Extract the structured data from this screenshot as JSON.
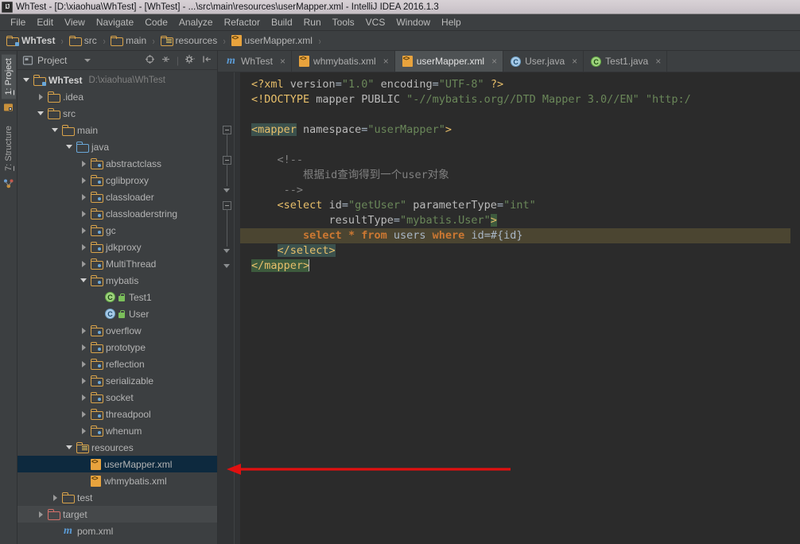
{
  "window": {
    "title": "WhTest - [D:\\xiaohua\\WhTest] - [WhTest] - ...\\src\\main\\resources\\userMapper.xml - IntelliJ IDEA 2016.1.3",
    "app_icon": "IJ"
  },
  "menubar": {
    "items": [
      {
        "label": "File",
        "mnemonic": "F"
      },
      {
        "label": "Edit",
        "mnemonic": "E"
      },
      {
        "label": "View",
        "mnemonic": "V"
      },
      {
        "label": "Navigate",
        "mnemonic": "N"
      },
      {
        "label": "Code",
        "mnemonic": "C"
      },
      {
        "label": "Analyze",
        "mnemonic": "A"
      },
      {
        "label": "Refactor",
        "mnemonic": "R"
      },
      {
        "label": "Build",
        "mnemonic": "B"
      },
      {
        "label": "Run",
        "mnemonic": "R"
      },
      {
        "label": "Tools",
        "mnemonic": "T"
      },
      {
        "label": "VCS",
        "mnemonic": "V"
      },
      {
        "label": "Window",
        "mnemonic": "W"
      },
      {
        "label": "Help",
        "mnemonic": "H"
      }
    ]
  },
  "breadcrumb": {
    "items": [
      {
        "label": "WhTest",
        "icon": "module-folder-icon"
      },
      {
        "label": "src",
        "icon": "folder-icon"
      },
      {
        "label": "main",
        "icon": "folder-icon"
      },
      {
        "label": "resources",
        "icon": "resources-folder-icon"
      },
      {
        "label": "userMapper.xml",
        "icon": "xml-file-icon"
      }
    ],
    "separator": "›"
  },
  "toolstrip": {
    "buttons": [
      {
        "num": "1",
        "label": ": Project",
        "active": true,
        "icon": "project-icon"
      },
      {
        "num": "7",
        "label": ": Structure",
        "active": false,
        "icon": "structure-icon"
      }
    ]
  },
  "project_panel": {
    "header": {
      "title": "Project",
      "icon": "project-view-icon",
      "dropdown": "chevron-down-icon",
      "tools": [
        "locate-icon",
        "collapse-all-icon",
        "settings-gear-icon",
        "hide-panel-icon"
      ]
    },
    "tree": [
      {
        "label": "WhTest",
        "sub": "D:\\xiaohua\\WhTest",
        "depth": 0,
        "arrow": "open",
        "icon": "module-folder-icon",
        "bold": true,
        "state": "normal"
      },
      {
        "label": ".idea",
        "sub": "",
        "depth": 1,
        "arrow": "closed",
        "icon": "folder-icon",
        "bold": false,
        "state": "normal"
      },
      {
        "label": "src",
        "sub": "",
        "depth": 1,
        "arrow": "open",
        "icon": "folder-icon",
        "bold": false,
        "state": "normal"
      },
      {
        "label": "main",
        "sub": "",
        "depth": 2,
        "arrow": "open",
        "icon": "folder-icon",
        "bold": false,
        "state": "normal"
      },
      {
        "label": "java",
        "sub": "",
        "depth": 3,
        "arrow": "open",
        "icon": "source-folder-icon",
        "bold": false,
        "state": "normal"
      },
      {
        "label": "abstractclass",
        "sub": "",
        "depth": 4,
        "arrow": "closed",
        "icon": "package-icon",
        "bold": false,
        "state": "normal"
      },
      {
        "label": "cglibproxy",
        "sub": "",
        "depth": 4,
        "arrow": "closed",
        "icon": "package-icon",
        "bold": false,
        "state": "normal"
      },
      {
        "label": "classloader",
        "sub": "",
        "depth": 4,
        "arrow": "closed",
        "icon": "package-icon",
        "bold": false,
        "state": "normal"
      },
      {
        "label": "classloaderstring",
        "sub": "",
        "depth": 4,
        "arrow": "closed",
        "icon": "package-icon",
        "bold": false,
        "state": "normal"
      },
      {
        "label": "gc",
        "sub": "",
        "depth": 4,
        "arrow": "closed",
        "icon": "package-icon",
        "bold": false,
        "state": "normal"
      },
      {
        "label": "jdkproxy",
        "sub": "",
        "depth": 4,
        "arrow": "closed",
        "icon": "package-icon",
        "bold": false,
        "state": "normal"
      },
      {
        "label": "MultiThread",
        "sub": "",
        "depth": 4,
        "arrow": "closed",
        "icon": "package-icon",
        "bold": false,
        "state": "normal"
      },
      {
        "label": "mybatis",
        "sub": "",
        "depth": 4,
        "arrow": "open",
        "icon": "package-icon",
        "bold": false,
        "state": "normal"
      },
      {
        "label": "Test1",
        "sub": "",
        "depth": 5,
        "arrow": "none",
        "icon": "runnable-class-icon",
        "bold": false,
        "state": "normal"
      },
      {
        "label": "User",
        "sub": "",
        "depth": 5,
        "arrow": "none",
        "icon": "class-icon",
        "bold": false,
        "state": "normal"
      },
      {
        "label": "overflow",
        "sub": "",
        "depth": 4,
        "arrow": "closed",
        "icon": "package-icon",
        "bold": false,
        "state": "normal"
      },
      {
        "label": "prototype",
        "sub": "",
        "depth": 4,
        "arrow": "closed",
        "icon": "package-icon",
        "bold": false,
        "state": "normal"
      },
      {
        "label": "reflection",
        "sub": "",
        "depth": 4,
        "arrow": "closed",
        "icon": "package-icon",
        "bold": false,
        "state": "normal"
      },
      {
        "label": "serializable",
        "sub": "",
        "depth": 4,
        "arrow": "closed",
        "icon": "package-icon",
        "bold": false,
        "state": "normal"
      },
      {
        "label": "socket",
        "sub": "",
        "depth": 4,
        "arrow": "closed",
        "icon": "package-icon",
        "bold": false,
        "state": "normal"
      },
      {
        "label": "threadpool",
        "sub": "",
        "depth": 4,
        "arrow": "closed",
        "icon": "package-icon",
        "bold": false,
        "state": "normal"
      },
      {
        "label": "whenum",
        "sub": "",
        "depth": 4,
        "arrow": "closed",
        "icon": "package-icon",
        "bold": false,
        "state": "normal"
      },
      {
        "label": "resources",
        "sub": "",
        "depth": 3,
        "arrow": "open",
        "icon": "resources-folder-icon",
        "bold": false,
        "state": "normal"
      },
      {
        "label": "userMapper.xml",
        "sub": "",
        "depth": 4,
        "arrow": "none",
        "icon": "xml-file-icon",
        "bold": false,
        "state": "selected"
      },
      {
        "label": "whmybatis.xml",
        "sub": "",
        "depth": 4,
        "arrow": "none",
        "icon": "xml-file-icon",
        "bold": false,
        "state": "normal"
      },
      {
        "label": "test",
        "sub": "",
        "depth": 2,
        "arrow": "closed",
        "icon": "folder-icon",
        "bold": false,
        "state": "normal"
      },
      {
        "label": "target",
        "sub": "",
        "depth": 1,
        "arrow": "closed",
        "icon": "excluded-folder-icon",
        "bold": false,
        "state": "hovered"
      },
      {
        "label": "pom.xml",
        "sub": "",
        "depth": 2,
        "arrow": "none",
        "icon": "maven-icon",
        "bold": false,
        "state": "normal"
      }
    ]
  },
  "editor_tabs": [
    {
      "label": "WhTest",
      "icon": "maven-icon",
      "active": false,
      "close": "×"
    },
    {
      "label": "whmybatis.xml",
      "icon": "xml-file-icon",
      "active": false,
      "close": "×"
    },
    {
      "label": "userMapper.xml",
      "icon": "xml-file-icon",
      "active": true,
      "close": "×"
    },
    {
      "label": "User.java",
      "icon": "class-icon",
      "active": false,
      "close": "×"
    },
    {
      "label": "Test1.java",
      "icon": "runnable-class-icon",
      "active": false,
      "close": "×"
    }
  ],
  "code": {
    "filename": "userMapper.xml",
    "lines": [
      "<?xml version=\"1.0\" encoding=\"UTF-8\" ?>",
      "<!DOCTYPE mapper PUBLIC \"-//mybatis.org//DTD Mapper 3.0//EN\" \"http:/",
      "",
      "<mapper namespace=\"userMapper\">",
      "",
      "    <!--",
      "        根据id查询得到一个user对象",
      "     -->",
      "    <select id=\"getUser\" parameterType=\"int\"",
      "            resultType=\"mybatis.User\">",
      "        select * from users where id=#{id}",
      "    </select>",
      "</mapper>"
    ],
    "highlighted_line": "select * from users where id=#{id}",
    "caret_line": "</mapper>"
  },
  "annotation": {
    "arrow_color": "#e01010",
    "label": "red-arrow-pointing-to-userMapper-xml"
  },
  "colors": {
    "bg_panel": "#3c3f41",
    "bg_editor": "#2b2b2b",
    "selection": "#0d293e",
    "tab_active": "#4e5254",
    "accent_xml": "#e8a33d",
    "sql_highlight": "#4b4531"
  }
}
